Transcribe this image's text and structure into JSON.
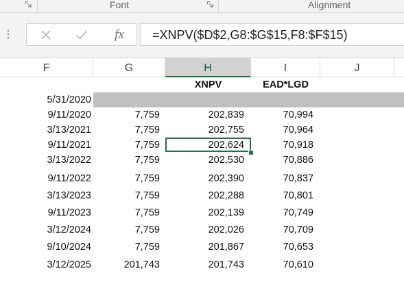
{
  "ribbon": {
    "groups": [
      {
        "label": "Font"
      },
      {
        "label": "Alignment"
      }
    ]
  },
  "formula_bar": {
    "cancel_icon": "close-icon",
    "enter_icon": "checkmark-icon",
    "function_icon": "fx-icon",
    "function_label": "fx",
    "formula": "=XNPV($D$2,G8:$G$15,F8:$F$15)"
  },
  "columns": [
    "F",
    "G",
    "H",
    "I",
    "J"
  ],
  "active_column": "H",
  "header_row": {
    "H": "XNPV",
    "I": "EAD*LGD"
  },
  "rows": [
    {
      "F": "5/31/2020",
      "G": "",
      "H": "",
      "I": ""
    },
    {
      "F": "9/11/2020",
      "G": "7,759",
      "H": "202,839",
      "I": "70,994"
    },
    {
      "F": "3/13/2021",
      "G": "7,759",
      "H": "202,755",
      "I": "70,964"
    },
    {
      "F": "9/11/2021",
      "G": "7,759",
      "H": "202,624",
      "I": "70,918"
    },
    {
      "F": "3/13/2022",
      "G": "7,759",
      "H": "202,530",
      "I": "70,886"
    },
    {
      "F": "9/11/2022",
      "G": "7,759",
      "H": "202,390",
      "I": "70,837"
    },
    {
      "F": "3/13/2023",
      "G": "7,759",
      "H": "202,288",
      "I": "70,801"
    },
    {
      "F": "9/11/2023",
      "G": "7,759",
      "H": "202,139",
      "I": "70,749"
    },
    {
      "F": "3/12/2024",
      "G": "7,759",
      "H": "202,026",
      "I": "70,709"
    },
    {
      "F": "9/10/2024",
      "G": "7,759",
      "H": "201,867",
      "I": "70,653"
    },
    {
      "F": "3/12/2025",
      "G": "201,743",
      "H": "201,743",
      "I": "70,610"
    }
  ],
  "selected_cell": {
    "column": "H",
    "value": "202,624"
  },
  "colors": {
    "selection": "#217346",
    "highlight_band": "#c0c0c0",
    "ribbon_bg": "#f3f3f3"
  }
}
